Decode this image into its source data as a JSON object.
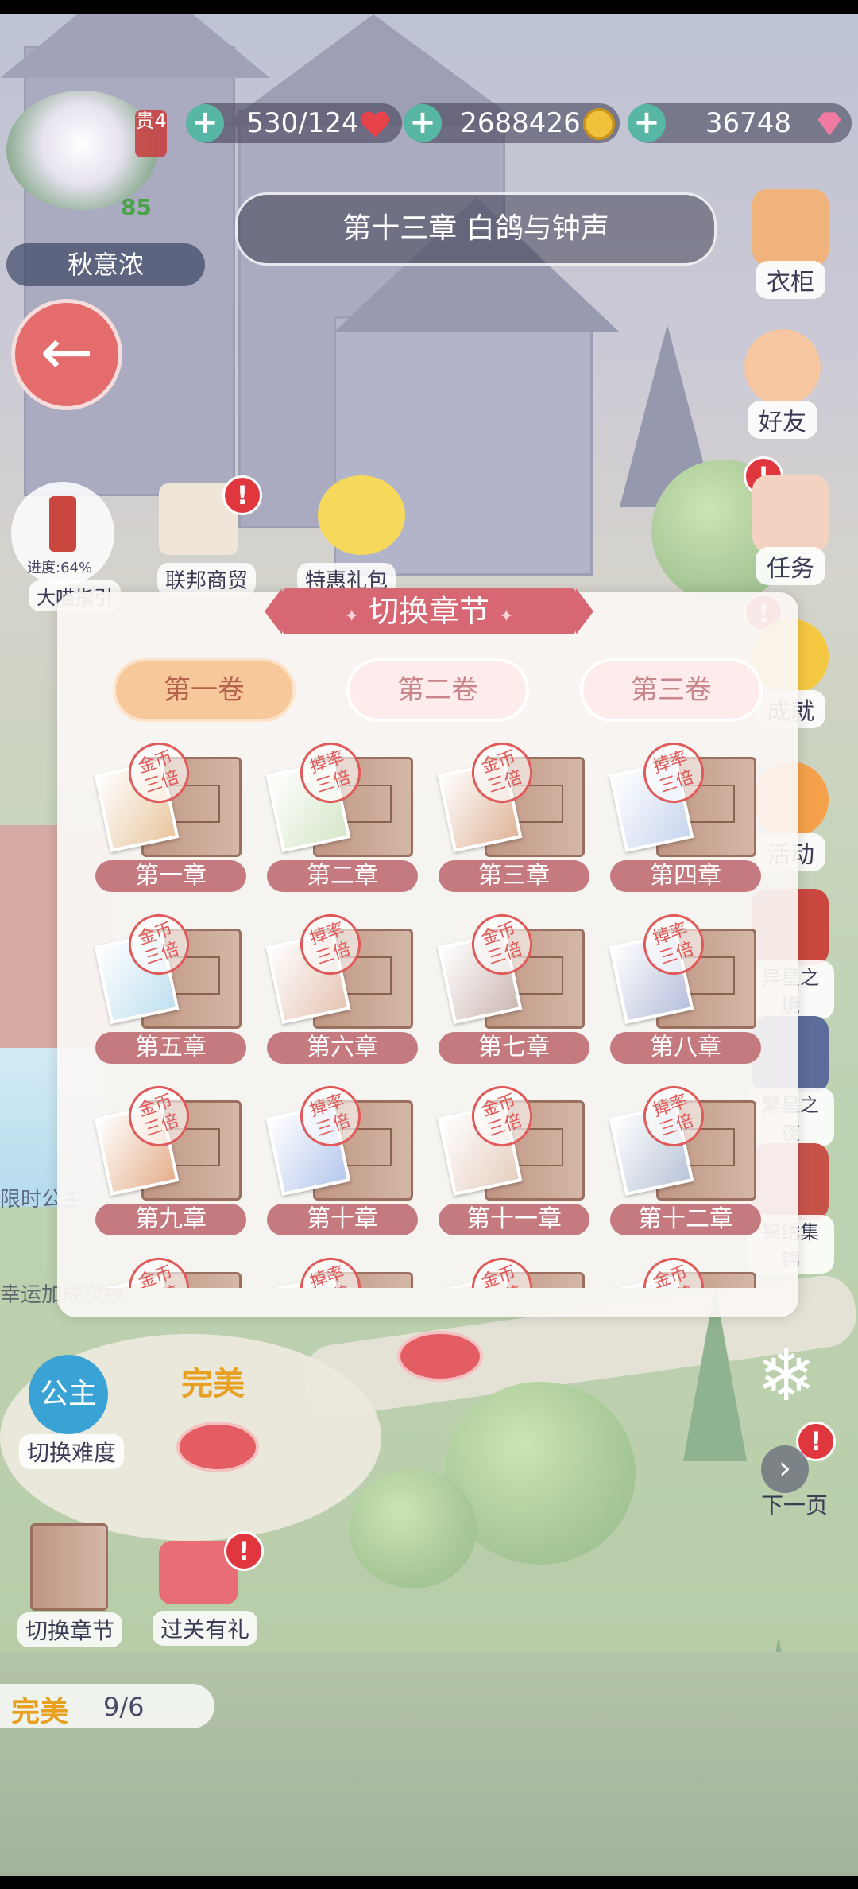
{
  "player": {
    "name": "秋意浓",
    "level": "85",
    "badge": "贵4"
  },
  "resources": [
    {
      "value": "530/124",
      "icon": "heart-icon",
      "color": "#e8424b"
    },
    {
      "value": "2688426",
      "icon": "gold-coin-icon",
      "color": "#f0c23a"
    },
    {
      "value": "36748",
      "icon": "pink-gem-icon",
      "color": "#f07aa0"
    }
  ],
  "chapter_banner": "第十三章 白鸽与钟声",
  "left_actions": [
    {
      "label": "大喵指引",
      "progress": "进度:64%"
    },
    {
      "label": "联邦商贸"
    },
    {
      "label": "特惠礼包"
    }
  ],
  "side_menu": [
    {
      "label": "衣柜"
    },
    {
      "label": "好友"
    },
    {
      "label": "任务"
    },
    {
      "label": "成就"
    },
    {
      "label": "活动"
    },
    {
      "label": "异星之境"
    },
    {
      "label": "繁星之夜"
    },
    {
      "label": "锦绣集锦"
    }
  ],
  "modal": {
    "title": "切换章节",
    "volumes": [
      "第一卷",
      "第二卷",
      "第三卷"
    ],
    "active_volume": "第一卷",
    "chapters": [
      {
        "label": "第一章",
        "stamp": "金币三倍"
      },
      {
        "label": "第二章",
        "stamp": "掉率三倍"
      },
      {
        "label": "第三章",
        "stamp": "金币三倍"
      },
      {
        "label": "第四章",
        "stamp": "掉率三倍"
      },
      {
        "label": "第五章",
        "stamp": "金币三倍"
      },
      {
        "label": "第六章",
        "stamp": "掉率三倍"
      },
      {
        "label": "第七章",
        "stamp": "金币三倍"
      },
      {
        "label": "第八章",
        "stamp": "掉率三倍"
      },
      {
        "label": "第九章",
        "stamp": "金币三倍"
      },
      {
        "label": "第十章",
        "stamp": "掉率三倍"
      },
      {
        "label": "第十一章",
        "stamp": "金币三倍"
      },
      {
        "label": "第十二章",
        "stamp": "掉率三倍"
      },
      {
        "label": "",
        "stamp": "金币三倍"
      },
      {
        "label": "",
        "stamp": "掉率三倍"
      },
      {
        "label": "",
        "stamp": "金币三倍"
      },
      {
        "label": "",
        "stamp": "金币三倍"
      }
    ]
  },
  "bottom": {
    "difficulty_badge": "公主",
    "difficulty_label": "切换难度",
    "perfect_tag": "完美",
    "switch_chapter_label": "切换章节",
    "reward_label": "过关有礼",
    "next_page_label": "下一页",
    "progress_label": "完美",
    "progress_value": "9/6",
    "limited_text": "限时公主",
    "luck_text": "幸运加成次数"
  }
}
